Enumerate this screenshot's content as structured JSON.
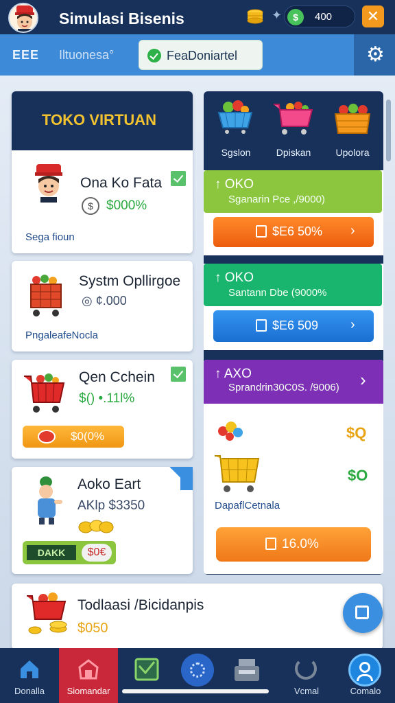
{
  "header": {
    "title": "Simulasi Bisenis",
    "balance": "400",
    "close": "✕"
  },
  "subbar": {
    "left_label": "EEE",
    "second_label": "Iltuonesa°",
    "pill_label": "FeaDoniartel"
  },
  "toko_card": {
    "title": "TOKO VIRTUAN",
    "name": "Ona Ko Fata",
    "amount": "$000%",
    "footer": "Sega fioun"
  },
  "shop_items": [
    {
      "name": "Systm Opllirgoe",
      "amount": "◎ ¢.000",
      "footer": "PngaleafeNocla"
    },
    {
      "name": "Qen Cchein",
      "amount": "$() •.11l%",
      "button": "$0(0%"
    },
    {
      "name": "Aoko Eart",
      "amount": "AKlp $3350",
      "tag_a": "DAKK",
      "tag_b": "$0€"
    }
  ],
  "categories": [
    {
      "label": "Sgslon",
      "icon": "fruit-basket-icon"
    },
    {
      "label": "Dpiskan",
      "icon": "shopping-cart-icon"
    },
    {
      "label": "Upolora",
      "icon": "produce-crate-icon"
    }
  ],
  "offers": [
    {
      "title": "↑ OKO",
      "sub": "Sganarin Pce ,/9000)",
      "button": "$E6 50%",
      "color": "#8cc63f"
    },
    {
      "title": "↑ OKO",
      "sub": "Santann Dbe (9000%",
      "button": "$E6 509",
      "color": "#19b46e"
    },
    {
      "title": "↑ AXO",
      "sub": "Sprandrin30C0S. /9006)",
      "color": "#7d2fb6"
    }
  ],
  "purple_panel": {
    "values": [
      "$Q",
      "$O"
    ],
    "footer": "DapaflCetnala",
    "button": "16.0%"
  },
  "bottom_card": {
    "name": "Todlaasi /Bicidanpis",
    "amount": "$050"
  },
  "nav": [
    {
      "label": "Donalla",
      "icon": "home-icon",
      "active": false
    },
    {
      "label": "Siomandar",
      "icon": "store-icon",
      "active": true
    },
    {
      "label": "",
      "icon": "chart-icon",
      "active": false
    },
    {
      "label": "",
      "icon": "refresh-icon",
      "active": false
    },
    {
      "label": "",
      "icon": "cash-register-icon",
      "active": false
    },
    {
      "label": "Vcmal",
      "icon": "sync-icon",
      "active": false
    },
    {
      "label": "Comalo",
      "icon": "profile-icon",
      "active": false
    }
  ],
  "colors": {
    "navy": "#17315a",
    "blue_bar": "#3c8ad8",
    "orange": "#f39a1e",
    "green": "#8cc63f",
    "teal": "#19b46e",
    "purple": "#7d2fb6",
    "red_nav": "#c8283a"
  }
}
